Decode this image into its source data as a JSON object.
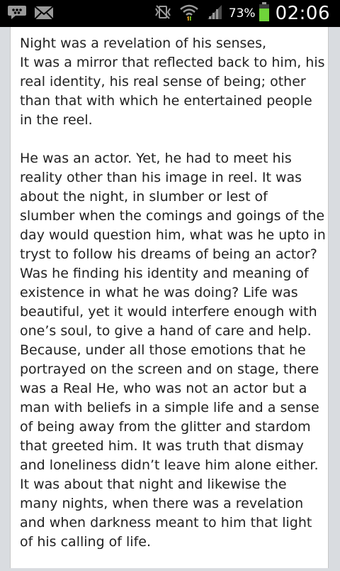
{
  "status_bar": {
    "battery_percent": "73%",
    "time": "02:06"
  },
  "story": {
    "paragraph_1": "Night was a revelation of his senses,\nIt was a mirror that reflected back to him, his real identity, his real sense of being; other than that with which he entertained people in the reel.",
    "paragraph_2": "He was an actor. Yet, he had to meet his reality other than his image in reel. It was about the night, in slumber or lest of slumber when the comings and goings of the day would question him, what was he upto in tryst to follow his dreams of being an actor? Was he finding his identity and meaning of existence in what he was doing? Life was beautiful, yet it would interfere enough with one’s soul, to give a hand of care and help. Because, under all those emotions that he portrayed on the screen and on stage, there was a Real He, who was not an actor but a man with beliefs in a simple life and a sense of being away from the glitter and stardom that greeted him. It was truth that dismay and loneliness didn’t leave him alone either. It was about that night and likewise the many nights, when there was a revelation and when darkness meant to him that light of his calling of life."
  }
}
